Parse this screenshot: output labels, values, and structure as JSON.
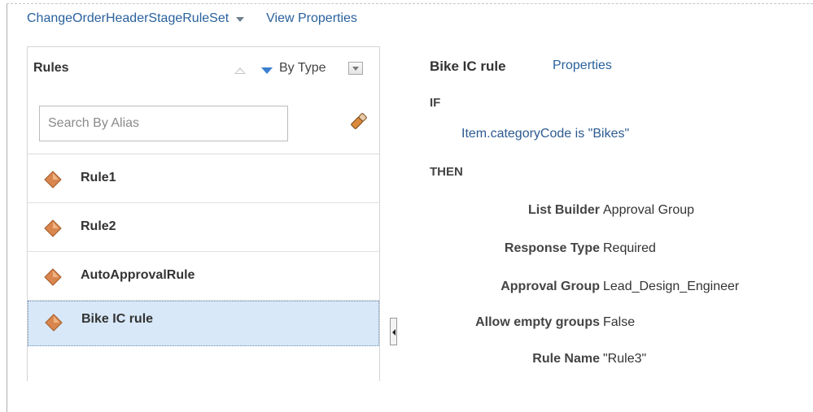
{
  "header": {
    "ruleset_name": "ChangeOrderHeaderStageRuleSet",
    "view_properties_link": "View Properties"
  },
  "rules_panel": {
    "title": "Rules",
    "sort_label": "By Type",
    "search_placeholder": "Search By Alias",
    "items": [
      {
        "label": "Rule1",
        "selected": false
      },
      {
        "label": "Rule2",
        "selected": false
      },
      {
        "label": "AutoApprovalRule",
        "selected": false
      },
      {
        "label": "Bike IC rule",
        "selected": true
      }
    ]
  },
  "detail": {
    "title": "Bike IC rule",
    "properties_link": "Properties",
    "if_label": "IF",
    "condition": {
      "field": "Item.categoryCode",
      "operator": "is",
      "value": "\"Bikes\""
    },
    "then_label": "THEN",
    "actions": [
      {
        "key": "List Builder",
        "value": "Approval Group"
      },
      {
        "key": "Response Type",
        "value": "Required"
      },
      {
        "key": "Approval Group",
        "value": "Lead_Design_Engineer"
      },
      {
        "key": "Allow empty groups",
        "value": "False"
      },
      {
        "key": "Rule Name",
        "value": "\"Rule3\""
      }
    ]
  },
  "colors": {
    "link": "#29619d",
    "selected_row": "#d8e8f8",
    "rule_icon": "#d9864e"
  }
}
